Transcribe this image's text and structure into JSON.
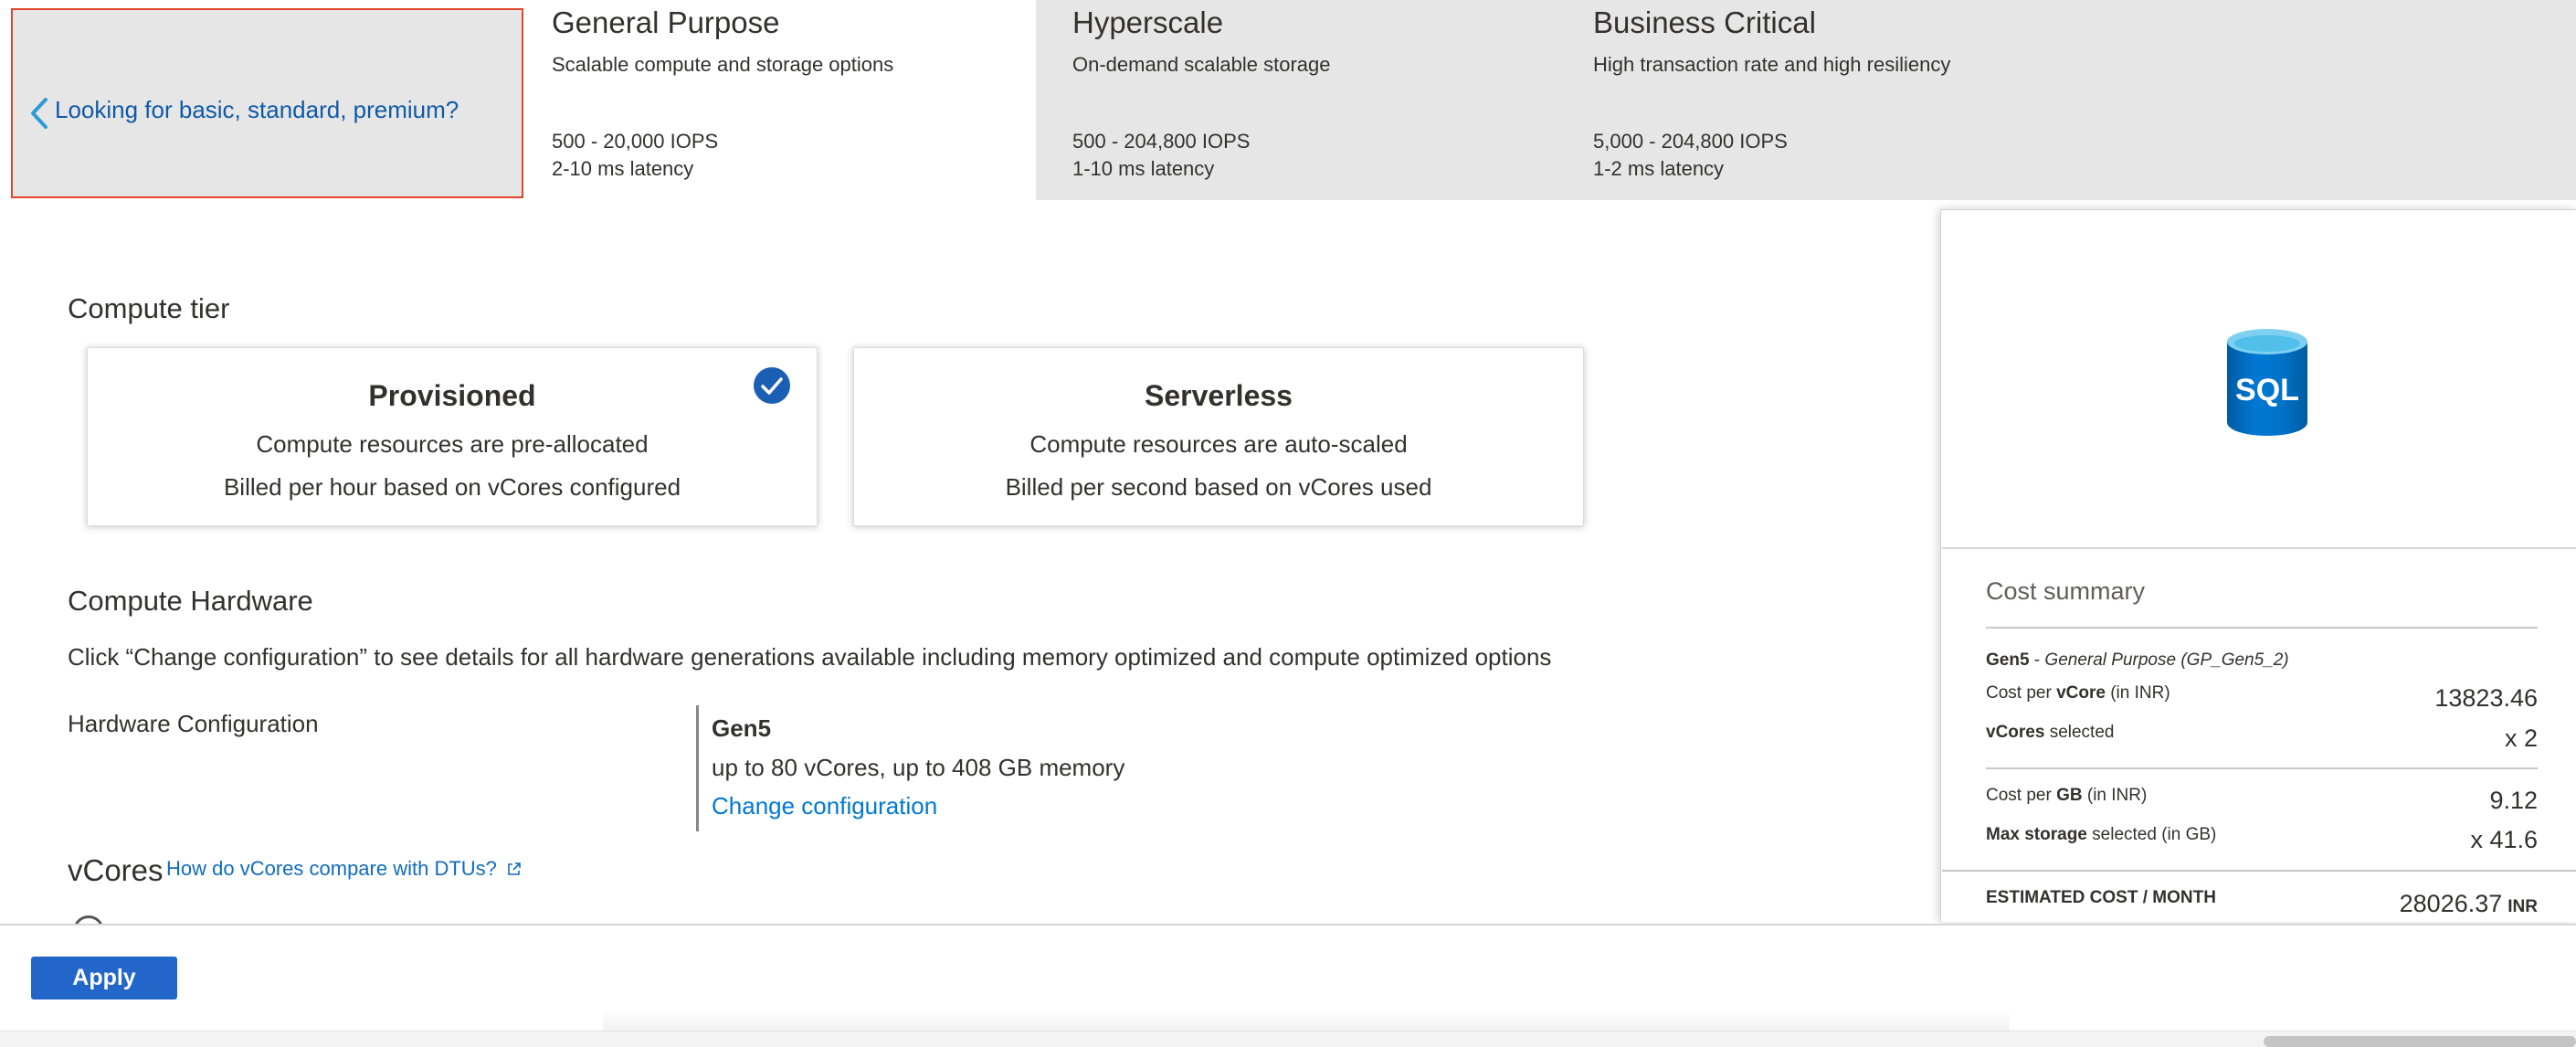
{
  "tiers": {
    "back_label": "Looking for basic, standard, premium?",
    "items": [
      {
        "title": "General Purpose",
        "subtitle": "Scalable compute and storage options",
        "iops": "500 - 20,000 IOPS",
        "latency": "2-10 ms latency"
      },
      {
        "title": "Hyperscale",
        "subtitle": "On-demand scalable storage",
        "iops": "500 - 204,800 IOPS",
        "latency": "1-10 ms latency"
      },
      {
        "title": "Business Critical",
        "subtitle": "High transaction rate and high resiliency",
        "iops": "5,000 - 204,800 IOPS",
        "latency": "1-2 ms latency"
      }
    ]
  },
  "compute_tier": {
    "title": "Compute tier",
    "options": [
      {
        "title": "Provisioned",
        "line1": "Compute resources are pre-allocated",
        "line2": "Billed per hour based on vCores configured",
        "selected": true
      },
      {
        "title": "Serverless",
        "line1": "Compute resources are auto-scaled",
        "line2": "Billed per second based on vCores used",
        "selected": false
      }
    ]
  },
  "compute_hardware": {
    "title": "Compute Hardware",
    "description": "Click “Change configuration” to see details for all hardware generations available including memory optimized and compute optimized options",
    "config_label": "Hardware Configuration",
    "generation": "Gen5",
    "memory": "up to 80 vCores, up to 408 GB memory",
    "change_link": "Change configuration"
  },
  "vcores": {
    "title": "vCores",
    "compare_link": "How do vCores compare with DTUs?"
  },
  "cost_summary": {
    "icon_label": "SQL",
    "title": "Cost summary",
    "sku_gen": "Gen5",
    "sku_sep": " - ",
    "sku_desc": "General Purpose (GP_Gen5_2)",
    "cost_per_vcore": {
      "pre": "Cost per ",
      "bold": "vCore",
      "post": " (in INR)",
      "value": "13823.46"
    },
    "vcores_selected": {
      "bold": "vCores",
      "post": " selected",
      "value": "x 2"
    },
    "cost_per_gb": {
      "pre": "Cost per ",
      "bold": "GB",
      "post": " (in INR)",
      "value": "9.12"
    },
    "max_storage": {
      "bold": "Max storage",
      "post": " selected (in GB)",
      "value": "x 41.6"
    },
    "total_label": "ESTIMATED COST / MONTH",
    "total_value": "28026.37",
    "total_unit": "INR"
  },
  "footer": {
    "apply_label": "Apply"
  },
  "colors": {
    "accent": "#0078d4",
    "apply": "#2266c9",
    "selected_outline": "#e4432d",
    "sql_blue": "#0072c6"
  }
}
